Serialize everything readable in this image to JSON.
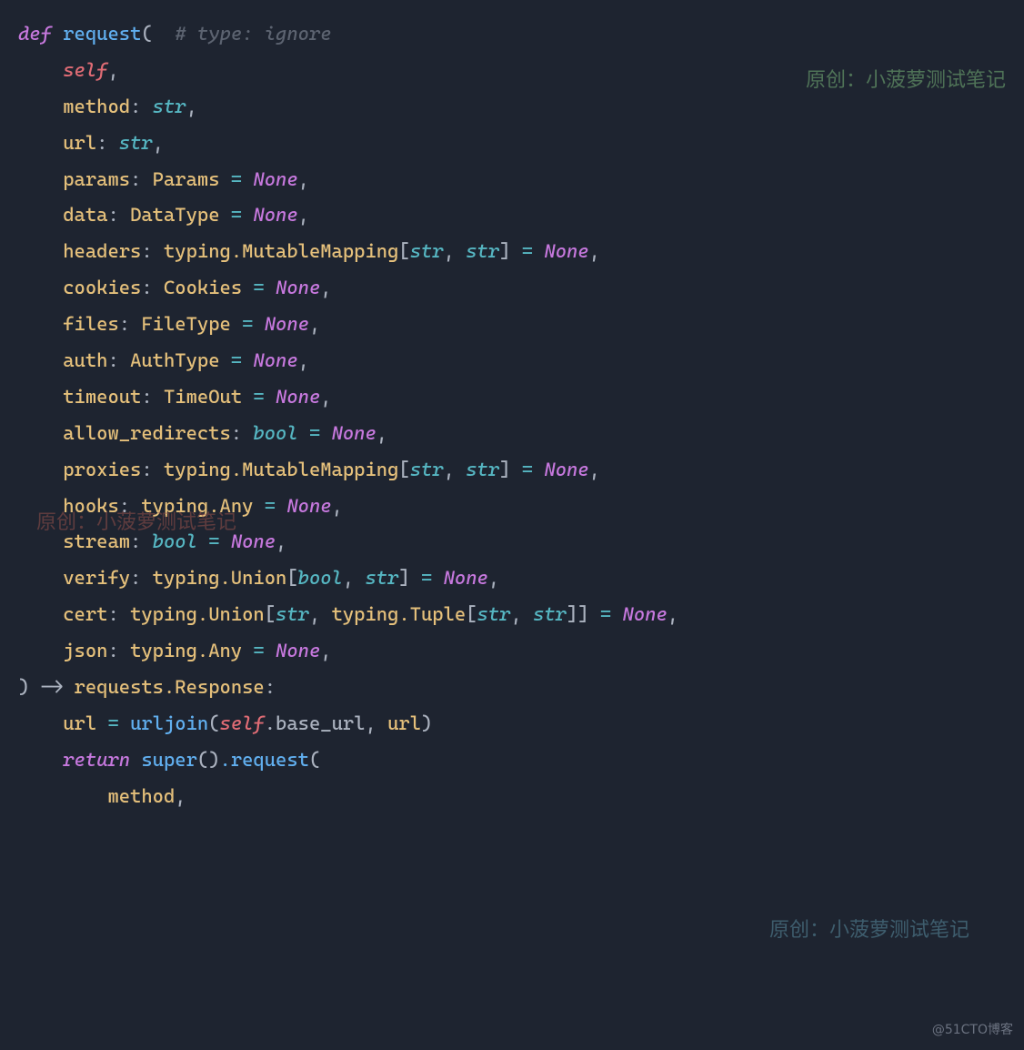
{
  "tok": {
    "def": "def",
    "request": "request",
    "lparen": "(",
    "rparen": ")",
    "comment_type_ignore": "# type: ignore",
    "self": "self",
    "method": "method",
    "str": "str",
    "url": "url",
    "params": "params",
    "Params": "Params",
    "None": "None",
    "data": "data",
    "DataType": "DataType",
    "headers": "headers",
    "typing_MutableMapping": "typing.MutableMapping",
    "cookies": "cookies",
    "Cookies": "Cookies",
    "files": "files",
    "FileType": "FileType",
    "auth": "auth",
    "AuthType": "AuthType",
    "timeout": "timeout",
    "TimeOut": "TimeOut",
    "allow_redirects": "allow_redirects",
    "bool": "bool",
    "proxies": "proxies",
    "hooks": "hooks",
    "typing_Any": "typing.Any",
    "stream": "stream",
    "verify": "verify",
    "typing_Union": "typing.Union",
    "cert": "cert",
    "typing_Tuple": "typing.Tuple",
    "json": "json",
    "arrow": "->",
    "requests_Response": "requests.Response",
    "urljoin": "urljoin",
    "base_url": ".base_url",
    "return": "return",
    "super": "super",
    "dot_request": ".request",
    "comma": ",",
    "colon": ":",
    "eq": " = ",
    "lbr": "[",
    "rbr": "]",
    "sep": ", "
  },
  "watermarks": {
    "w1": "原创：小菠萝测试笔记",
    "w2": "原创：小菠萝测试笔记",
    "w3": "原创：小菠萝测试笔记"
  },
  "footer": "@51CTO博客"
}
